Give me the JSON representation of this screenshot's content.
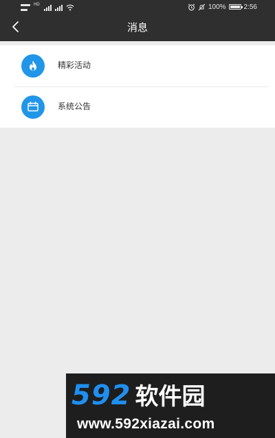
{
  "status_bar": {
    "network_label": "HD",
    "battery_percent_text": "100%",
    "battery_level": 1.0,
    "time": "2:56",
    "icons": [
      "sim-icon",
      "signal-icon",
      "wifi-icon",
      "alarm-icon",
      "mute-icon",
      "battery-icon"
    ]
  },
  "nav": {
    "title": "消息",
    "back_icon": "chevron-left-icon"
  },
  "messages": {
    "items": [
      {
        "label": "精彩活动",
        "icon": "flame-icon"
      },
      {
        "label": "系统公告",
        "icon": "notice-icon"
      }
    ]
  },
  "watermark": {
    "digits": "592",
    "name": "软件园",
    "url": "www.592xiazai.com"
  },
  "colors": {
    "header_bg": "#2f2f2f",
    "icon_blue": "#2196e8",
    "page_bg": "#ececec",
    "watermark_blue": "#1f8ff0"
  }
}
